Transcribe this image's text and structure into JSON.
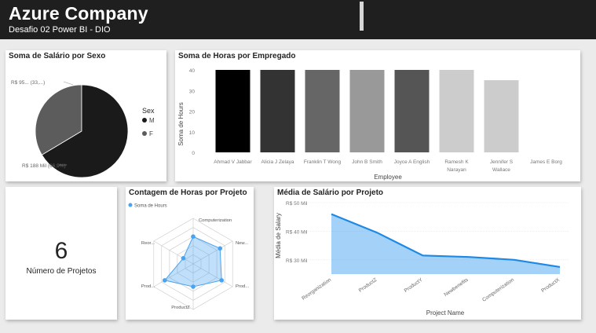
{
  "header": {
    "title": "Azure Company",
    "subtitle": "Desafio 02  Power BI - DIO"
  },
  "pie": {
    "title": "Soma de Salário por Sexo",
    "legend_title": "Sex",
    "label_small": "R$ 95... (33,...)",
    "label_large": "R$ 188 Mil (66,9%)"
  },
  "bar": {
    "title": "Soma de Horas por Empregado",
    "ylabel": "Soma de Hours",
    "xlabel": "Employee",
    "yticks": [
      "0",
      "10",
      "20",
      "30",
      "40"
    ]
  },
  "kpi": {
    "value": "6",
    "label": "Número de Projetos"
  },
  "radar": {
    "title": "Contagem de Horas por Projeto",
    "legend_label": "Soma de Hours"
  },
  "area": {
    "title": "Média de Salário por Projeto",
    "ylabel": "Média de Salary",
    "xlabel": "Project Name",
    "yticks": [
      "R$ 30 Mil",
      "R$ 40 Mil",
      "R$ 50 Mil"
    ]
  },
  "chart_data": [
    {
      "type": "pie",
      "title": "Soma de Salário por Sexo",
      "legend": [
        "M",
        "F"
      ],
      "slices": [
        {
          "name": "M",
          "value": 188,
          "percent": 66.9,
          "color": "#1a1a1a"
        },
        {
          "name": "F",
          "value": 95,
          "percent": 33.1,
          "color": "#5c5c5c"
        }
      ]
    },
    {
      "type": "bar",
      "title": "Soma de Horas por Empregado",
      "xlabel": "Employee",
      "ylabel": "Soma de Hours",
      "ylim": [
        0,
        40
      ],
      "categories": [
        "Ahmad V Jabbar",
        "Alicia J Zelaya",
        "Franklin T Wong",
        "John B Smith",
        "Joyce A English",
        "Ramesh K Narayan",
        "Jennifer S Wallace",
        "James E Borg"
      ],
      "category_lines": [
        [
          "Ahmad V Jabbar"
        ],
        [
          "Alicia J Zelaya"
        ],
        [
          "Franklin T Wong"
        ],
        [
          "John B Smith"
        ],
        [
          "Joyce A English"
        ],
        [
          "Ramesh K",
          "Narayan"
        ],
        [
          "Jennifer S",
          "Wallace"
        ],
        [
          "James E Borg"
        ]
      ],
      "values": [
        40,
        40,
        40,
        40,
        40,
        40,
        35,
        0
      ],
      "colors": [
        "#000000",
        "#333333",
        "#666666",
        "#999999",
        "#555555",
        "#cccccc",
        "#cccccc",
        "#cccccc"
      ]
    },
    {
      "type": "radar",
      "title": "Contagem de Horas por Projeto",
      "legend": [
        "Soma de Hours"
      ],
      "color": "#4aa3f0",
      "axes": [
        "Computerization",
        "New...",
        "Prod...",
        "ProductZ",
        "Prod...",
        "Reor..."
      ],
      "values": [
        0.6,
        0.68,
        0.72,
        0.5,
        0.72,
        0.25
      ]
    },
    {
      "type": "area",
      "title": "Média de Salário por Projeto",
      "xlabel": "Project Name",
      "ylabel": "Média de Salary",
      "ylim": [
        25,
        50
      ],
      "color": "#4aa3f0",
      "categories": [
        "Reorganization",
        "ProductZ",
        "ProductY",
        "Newbenefits",
        "Computerization",
        "ProductX"
      ],
      "values": [
        46,
        39.5,
        31.5,
        31,
        30,
        27.5
      ]
    }
  ]
}
